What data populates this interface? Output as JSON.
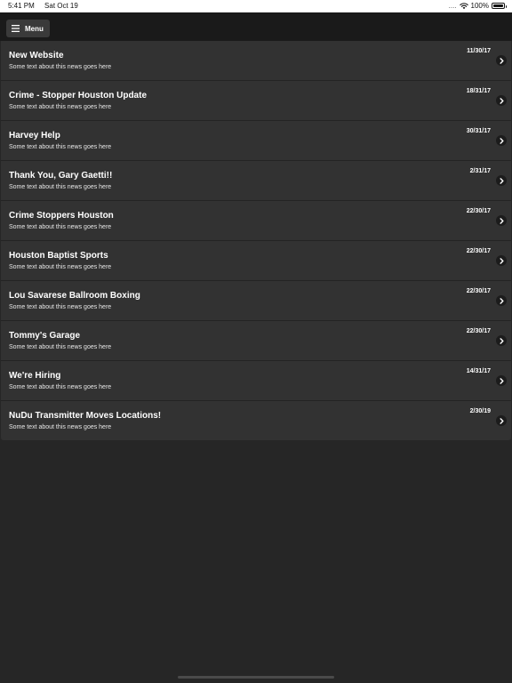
{
  "status_bar": {
    "time": "5:41 PM",
    "date": "Sat Oct 19",
    "signal": "....",
    "battery": "100%",
    "icons": [
      "wifi-icon",
      "battery-icon"
    ]
  },
  "header": {
    "menu_label": "Menu",
    "menu_icon": "hamburger-icon"
  },
  "news": [
    {
      "title": "New Website",
      "summary": "Some text about this news goes here",
      "date": "11/30/17"
    },
    {
      "title": "Crime - Stopper Houston Update",
      "summary": "Some text about this news goes here",
      "date": "18/31/17"
    },
    {
      "title": "Harvey Help",
      "summary": "Some text about this news goes here",
      "date": "30/31/17"
    },
    {
      "title": "Thank You, Gary Gaetti!!",
      "summary": "Some text about this news goes here",
      "date": "2/31/17"
    },
    {
      "title": "Crime Stoppers Houston",
      "summary": "Some text about this news goes here",
      "date": "22/30/17"
    },
    {
      "title": "Houston Baptist Sports",
      "summary": "Some text about this news goes here",
      "date": "22/30/17"
    },
    {
      "title": "Lou Savarese Ballroom Boxing",
      "summary": "Some text about this news goes here",
      "date": "22/30/17"
    },
    {
      "title": "Tommy's Garage",
      "summary": "Some text about this news goes here",
      "date": "22/30/17"
    },
    {
      "title": "We're Hiring",
      "summary": "Some text about this news goes here",
      "date": "14/31/17"
    },
    {
      "title": "NuDu Transmitter Moves Locations!",
      "summary": "Some text about this news goes here",
      "date": "2/30/19"
    }
  ],
  "colors": {
    "background": "#262626",
    "header": "#1a1a1a",
    "row": "#323232",
    "menu_button": "#3a3a3a",
    "text": "#ffffff"
  }
}
